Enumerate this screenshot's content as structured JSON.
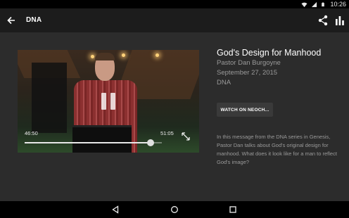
{
  "status_bar": {
    "time": "10:26",
    "icons": [
      "wifi-icon",
      "signal-icon",
      "battery-icon"
    ]
  },
  "app_bar": {
    "title": "DNA",
    "icons": [
      "back-arrow-icon",
      "share-icon",
      "bar-chart-icon"
    ]
  },
  "player": {
    "current_time": "46:50",
    "total_time": "51:05",
    "progress_fraction": 0.917,
    "state": "pause-icon"
  },
  "episode": {
    "title": "God's Design for Manhood",
    "speaker": "Pastor Dan Burgoyne",
    "date": "September 27, 2015",
    "series": "DNA",
    "watch_button": "WATCH ON NEOCH...",
    "description": "In this message from the DNA series in Genesis, Pastor Dan talks about God's original design for manhood. What does it look like for a man to reflect God's image?"
  },
  "nav_bar": {
    "icons": [
      "nav-back-icon",
      "nav-home-icon",
      "nav-recents-icon"
    ]
  },
  "colors": {
    "app_bar_bg": "#1c1c1c",
    "content_bg": "#2c2c2c",
    "secondary_text": "#9a9a9a",
    "button_bg": "#3a3a3a"
  }
}
